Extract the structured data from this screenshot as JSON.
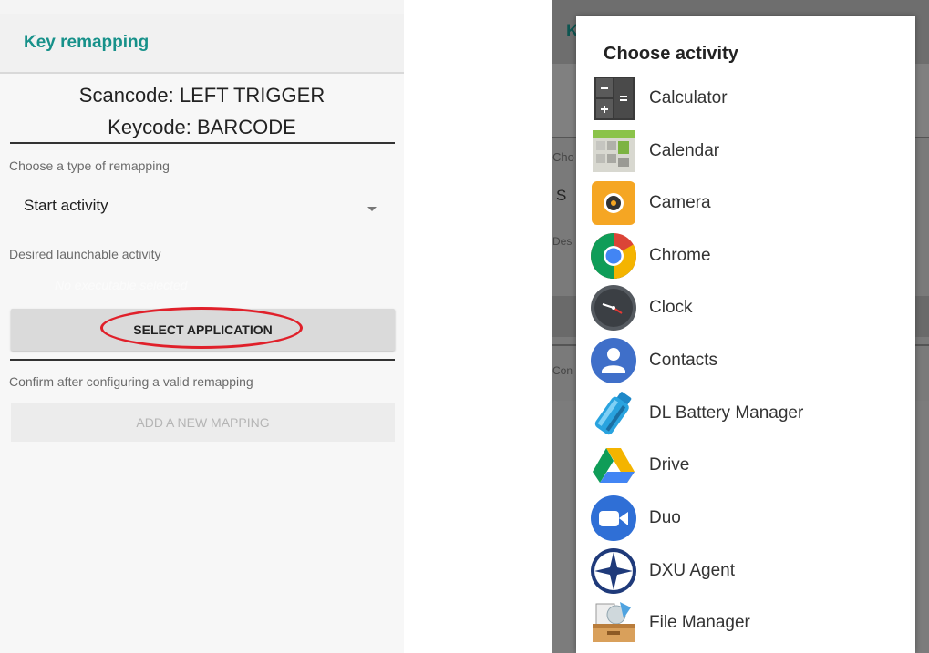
{
  "left": {
    "app_title": "Key remapping",
    "scancode": "Scancode: LEFT TRIGGER",
    "keycode": "Keycode: BARCODE",
    "remap_type_label": "Choose a type of remapping",
    "remap_type_value": "Start activity",
    "activity_label": "Desired launchable activity",
    "activity_value": "No executable selected",
    "select_button": "SELECT APPLICATION",
    "confirm_label": "Confirm after configuring a valid remapping",
    "add_button": "ADD A NEW MAPPING"
  },
  "right_bg": {
    "title_fragment": "K",
    "cho": "Cho",
    "s": "S",
    "des": "Des",
    "con": "Con"
  },
  "dialog": {
    "title": "Choose activity",
    "items": [
      {
        "label": "Calculator",
        "icon": "calculator-icon"
      },
      {
        "label": "Calendar",
        "icon": "calendar-icon"
      },
      {
        "label": "Camera",
        "icon": "camera-icon"
      },
      {
        "label": "Chrome",
        "icon": "chrome-icon"
      },
      {
        "label": "Clock",
        "icon": "clock-icon"
      },
      {
        "label": "Contacts",
        "icon": "contacts-icon"
      },
      {
        "label": "DL Battery Manager",
        "icon": "battery-manager-icon"
      },
      {
        "label": "Drive",
        "icon": "drive-icon"
      },
      {
        "label": "Duo",
        "icon": "duo-icon"
      },
      {
        "label": "DXU Agent",
        "icon": "dxu-agent-icon"
      },
      {
        "label": "File Manager",
        "icon": "file-manager-icon"
      }
    ]
  },
  "colors": {
    "accent": "#17918a",
    "highlight": "#e0202a"
  }
}
